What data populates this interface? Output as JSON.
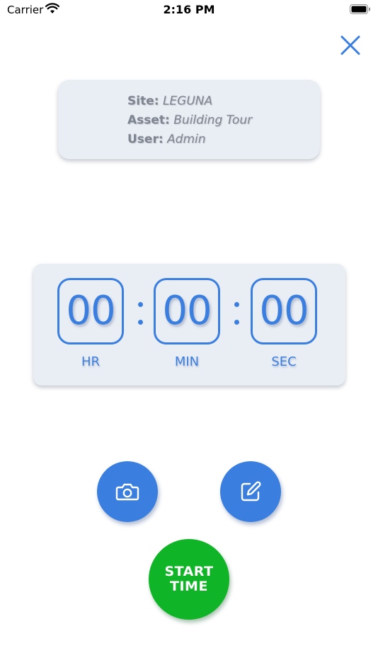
{
  "status_bar": {
    "carrier": "Carrier",
    "time": "2:16 PM"
  },
  "info": {
    "site_label": "Site:",
    "site_value": "LEGUNA",
    "asset_label": "Asset:",
    "asset_value": "Building Tour",
    "user_label": "User:",
    "user_value": "Admin"
  },
  "timer": {
    "hours": "00",
    "minutes": "00",
    "seconds": "00",
    "hours_label": "HR",
    "minutes_label": "MIN",
    "seconds_label": "SEC"
  },
  "actions": {
    "start_line1": "START",
    "start_line2": "TIME"
  },
  "icons": {
    "close": "close-icon",
    "camera": "camera-icon",
    "edit": "edit-icon",
    "wifi": "wifi-icon",
    "battery": "battery-icon"
  },
  "colors": {
    "accent": "#3a7fe0",
    "start": "#10b427",
    "card": "#e9edf4",
    "info_text": "#7f8590"
  }
}
